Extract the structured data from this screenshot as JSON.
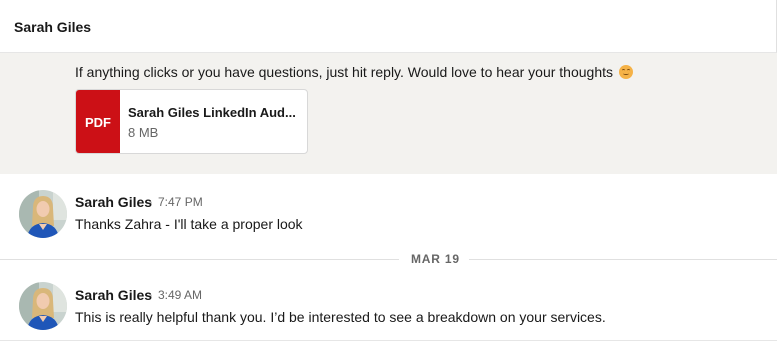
{
  "header": {
    "name": "Sarah Giles"
  },
  "highlighted": {
    "text": "If anything clicks or you have questions, just hit reply. Would love to hear your thoughts",
    "emoji": "smiling-face-icon",
    "attachment": {
      "badge": "PDF",
      "name": "Sarah Giles LinkedIn Aud...",
      "size": "8 MB"
    }
  },
  "messages": [
    {
      "sender": "Sarah Giles",
      "separator": "·",
      "time": "7:47 PM",
      "text": "Thanks Zahra - I'll take a proper look"
    },
    {
      "sender": "Sarah Giles",
      "separator": "·",
      "time": "3:49 AM",
      "text": "This is really helpful thank you. I’d be interested to see a breakdown on your services."
    }
  ],
  "date_divider": "MAR 19",
  "colors": {
    "pdf": "#cc1016",
    "highlight_bg": "#f3f2ef",
    "avatar_shirt": "#1f56b8"
  }
}
